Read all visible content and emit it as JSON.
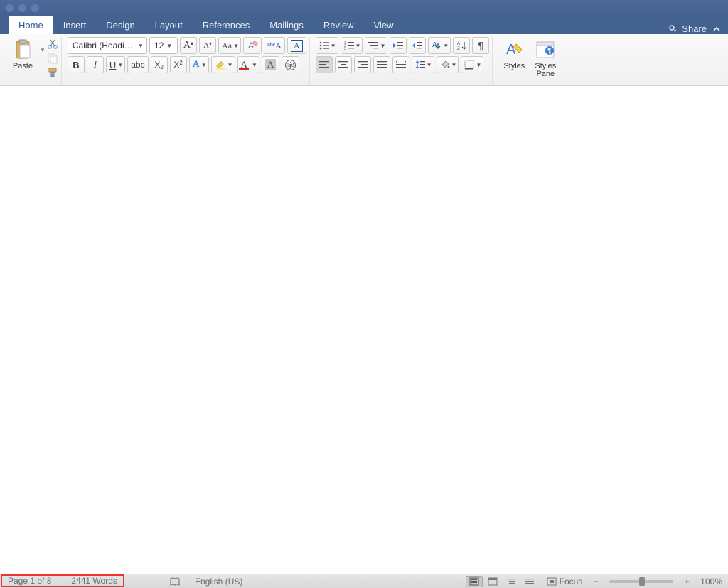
{
  "tabs": {
    "home": "Home",
    "insert": "Insert",
    "design": "Design",
    "layout": "Layout",
    "references": "References",
    "mailings": "Mailings",
    "review": "Review",
    "view": "View"
  },
  "share_label": "Share",
  "clipboard": {
    "paste_label": "Paste"
  },
  "font": {
    "name": "Calibri (Headin…",
    "size": "12"
  },
  "styles": {
    "styles_label": "Styles",
    "pane_label": "Styles\nPane"
  },
  "status": {
    "page": "Page 1 of 8",
    "words": "2441 Words",
    "language": "English (US)",
    "focus": "Focus",
    "zoom": "100%"
  }
}
